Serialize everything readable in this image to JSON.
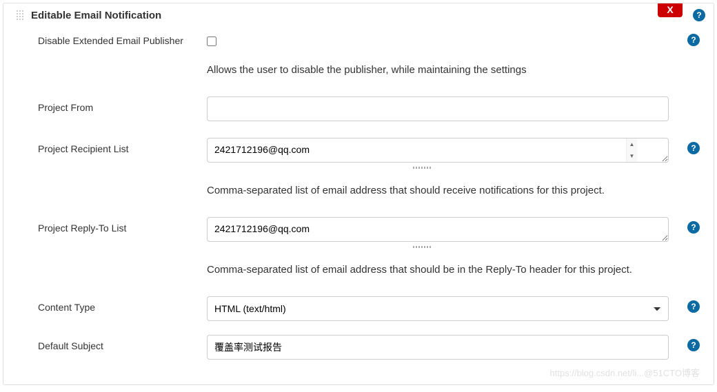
{
  "section": {
    "title": "Editable Email Notification",
    "delete_label": "X"
  },
  "fields": {
    "disable_publisher": {
      "label": "Disable Extended Email Publisher",
      "description": "Allows the user to disable the publisher, while maintaining the settings"
    },
    "project_from": {
      "label": "Project From",
      "value": ""
    },
    "recipient_list": {
      "label": "Project Recipient List",
      "value": "2421712196@qq.com",
      "description": "Comma-separated list of email address that should receive notifications for this project."
    },
    "reply_to_list": {
      "label": "Project Reply-To List",
      "value": "2421712196@qq.com",
      "description": "Comma-separated list of email address that should be in the Reply-To header for this project."
    },
    "content_type": {
      "label": "Content Type",
      "selected": "HTML (text/html)"
    },
    "default_subject": {
      "label": "Default Subject",
      "value": "覆盖率测试报告"
    }
  },
  "help_glyph": "?",
  "watermark": "https://blog.csdn.net/li...@51CTO博客"
}
